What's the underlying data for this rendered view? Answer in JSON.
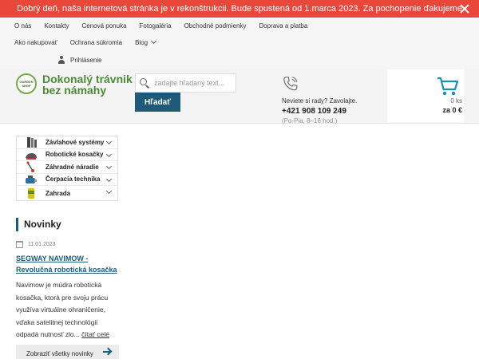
{
  "announcement": {
    "text": "Dobrý deň, naša internetová stránka je v rekonštrukcii. Bude spustená od 1.marca 2023. Za pochopenie ďakujeme",
    "close_icon": "close-icon",
    "bg_color": "#e8473a"
  },
  "topnav": {
    "row1": [
      "O nás",
      "Kontakty",
      "Cenová ponuka",
      "Fotogaléria",
      "Obchodné podmienky",
      "Doprava a platba"
    ],
    "row2": [
      "Ako nakupovať",
      "Ochrana súkromia",
      "Blog"
    ],
    "login_label": "Prihlásenie"
  },
  "logo": {
    "badge_text": "GARDEN SHOP",
    "line1": "Dokonalý trávnik",
    "line2": "bez námahy",
    "color": "#4c8a38"
  },
  "search": {
    "placeholder": "zadajte hľadaný text...",
    "value": "",
    "button_label": "Hľadať",
    "button_color": "#1f5a78"
  },
  "contact": {
    "question": "Neviete si rady? Zavolajte.",
    "phone": "+421 908 109 249",
    "hours": "(Po-Pia, 8–16 hod.)"
  },
  "cart": {
    "count": "0 ks",
    "total": "za 0 €",
    "icon_color": "#1f8fb0"
  },
  "categories": [
    {
      "label": "Závlahové systémy",
      "icon": "sprinkler-icon"
    },
    {
      "label": "Robotické kosačky",
      "icon": "robotic-mower-icon"
    },
    {
      "label": "Záhradné náradie",
      "icon": "garden-tools-icon"
    },
    {
      "label": "Čerpacia technika",
      "icon": "pump-icon"
    },
    {
      "label": "Zahrada",
      "icon": "garden-product-icon"
    }
  ],
  "news": {
    "heading": "Novinky",
    "date": "11.01.2023",
    "title": "SEGWAY NAVIMOW - Revolučná robotická kosačka",
    "text": "Navimow je múdra robotická kosačka, ktorá pre svoju prácu využíva virtuálne ohraničenie, vďaka satelitnej technológii odpadá nutnosť zlo...",
    "read_more": "čítať celé",
    "all_button": "Zobraziť všetky novinky",
    "accent": "#1f5a78"
  }
}
